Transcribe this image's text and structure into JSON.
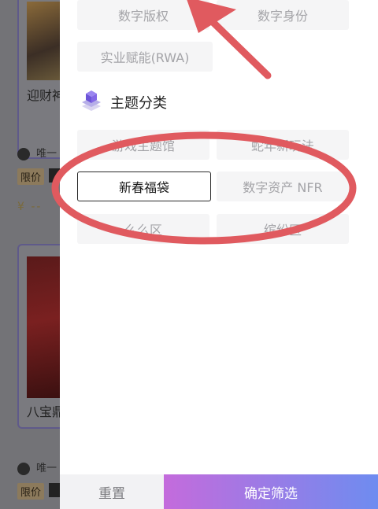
{
  "background": {
    "cards": [
      {
        "title": "迎财神",
        "author": "唯一",
        "tag": "限价",
        "price": "¥ --"
      },
      {
        "title": "八宝鼎",
        "author": "唯一",
        "tag": "限价"
      }
    ]
  },
  "filter_panel": {
    "top_chips": [
      "数字版权",
      "数字身份",
      "实业赋能(RWA)"
    ],
    "section_title": "主题分类",
    "theme_chips": [
      "游戏主题馆",
      "蛇年新玩法",
      "新春福袋",
      "数字资产 NFR",
      "么么区",
      "缤纷区"
    ],
    "selected_theme": "新春福袋"
  },
  "footer": {
    "reset_label": "重置",
    "confirm_label": "确定筛选"
  },
  "colors": {
    "accent_start": "#c46bdc",
    "accent_end": "#6e8cf0",
    "annotation": "#e05a5f"
  }
}
